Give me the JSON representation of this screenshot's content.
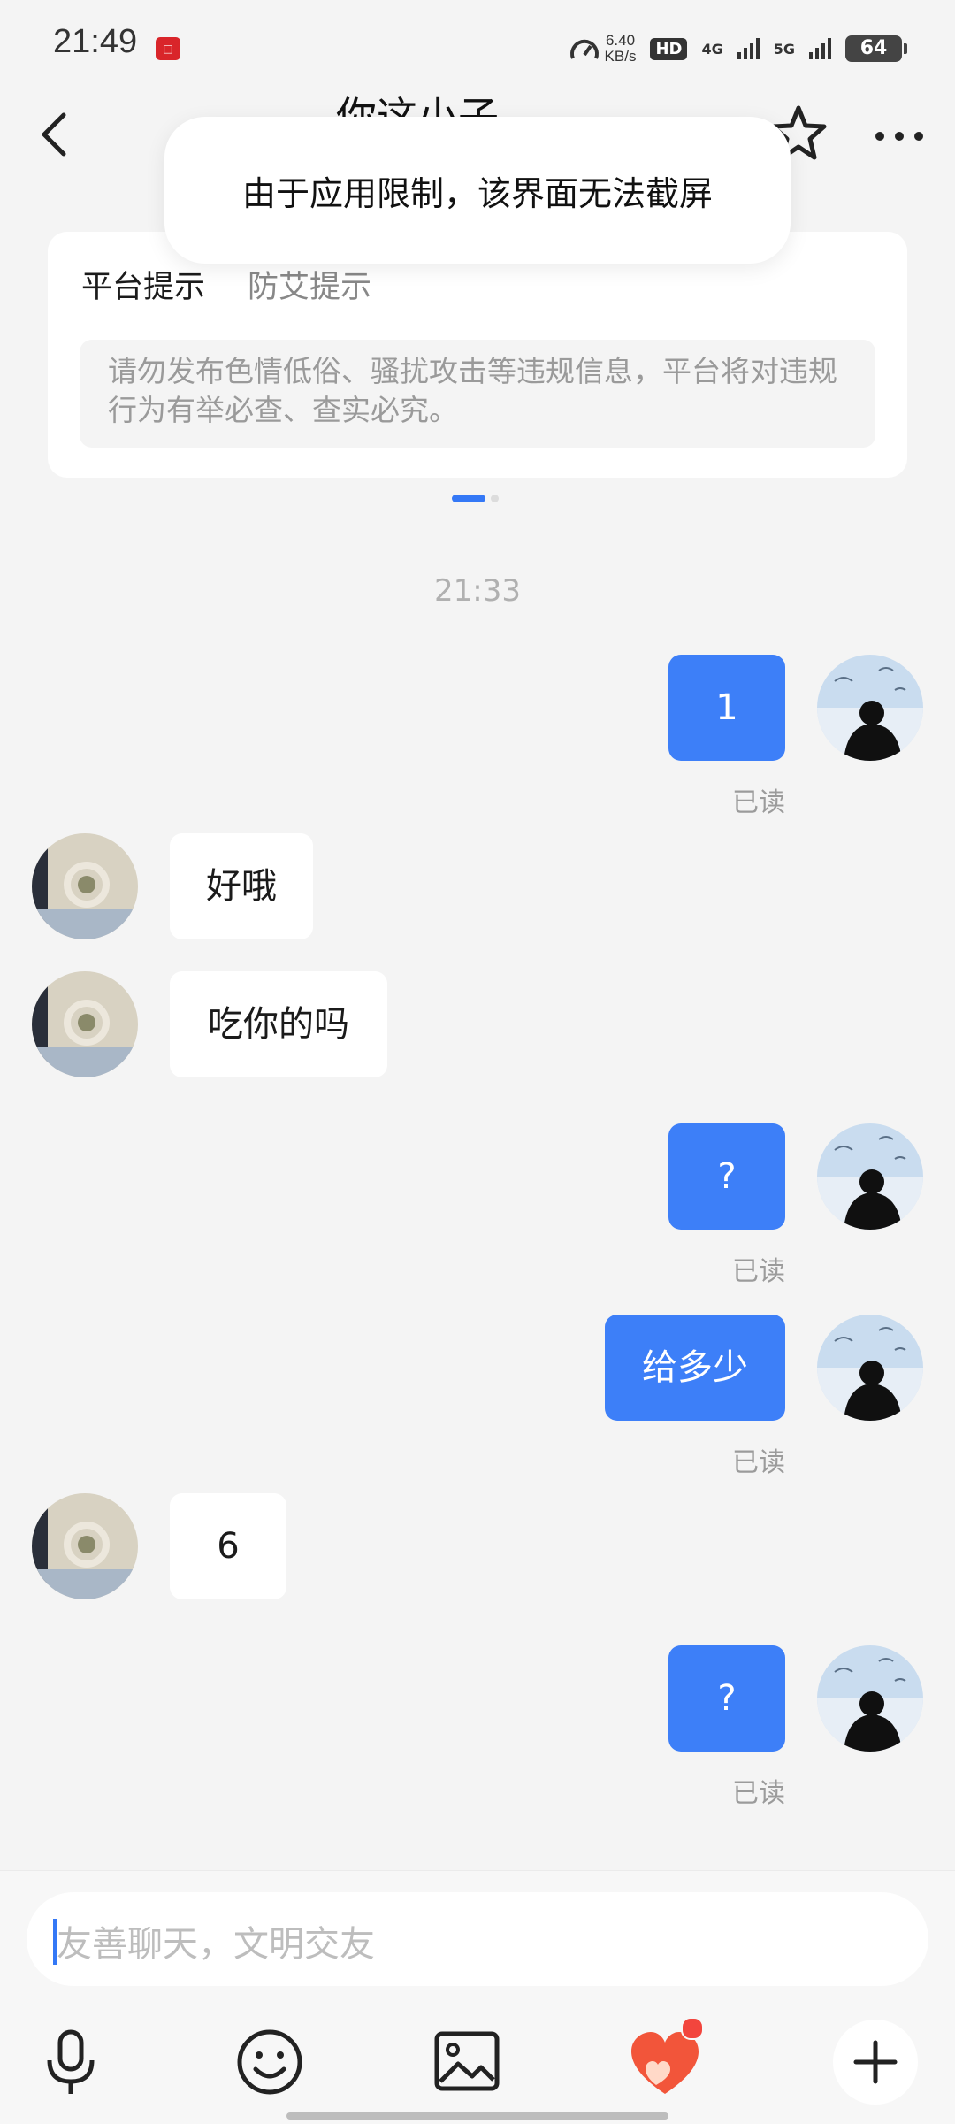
{
  "status_bar": {
    "time": "21:49",
    "net_speed_value": "6.40",
    "net_speed_unit": "KB/s",
    "hd_label": "HD",
    "net_4g": "4G",
    "net_5g": "5G",
    "battery": "64"
  },
  "header": {
    "title": "你这小子"
  },
  "toast": {
    "text": "由于应用限制，该界面无法截屏"
  },
  "notice": {
    "tabs": [
      {
        "label": "平台提示"
      },
      {
        "label": "防艾提示"
      }
    ],
    "body": "请勿发布色情低俗、骚扰攻击等违规信息，平台将对违规行为有举必查、查实必究。"
  },
  "chat": {
    "timestamp": "21:33",
    "messages": [
      {
        "direction": "out",
        "text": "1",
        "status": "已读"
      },
      {
        "direction": "in",
        "text": "好哦"
      },
      {
        "direction": "in",
        "text": "吃你的吗"
      },
      {
        "direction": "out",
        "text": "?",
        "status": "已读"
      },
      {
        "direction": "out",
        "text": "给多少",
        "status": "已读"
      },
      {
        "direction": "in",
        "text": "6"
      },
      {
        "direction": "out",
        "text": "?",
        "status": "已读"
      }
    ]
  },
  "input": {
    "placeholder": "友善聊天，文明交友"
  },
  "toolbar": {
    "icons": [
      "microphone-icon",
      "emoji-icon",
      "image-icon",
      "heart-gift-icon",
      "plus-icon"
    ]
  },
  "colors": {
    "accent": "#3d7ff8",
    "background": "#f4f4f4",
    "badge": "#f2453d"
  }
}
